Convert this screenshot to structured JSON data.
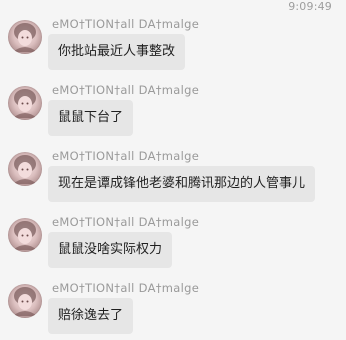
{
  "chat": {
    "timestamp": "9:09:49",
    "messages": [
      {
        "sender": "eMO†TION†all DA†malge",
        "text": "你批站最近人事整改"
      },
      {
        "sender": "eMO†TION†all DA†malge",
        "text": "鼠鼠下台了"
      },
      {
        "sender": "eMO†TION†all DA†malge",
        "text": "现在是谭成锋他老婆和腾讯那边的人管事儿"
      },
      {
        "sender": "eMO†TION†all DA†malge",
        "text": "鼠鼠没啥实际权力"
      },
      {
        "sender": "eMO†TION†all DA†malge",
        "text": "赔徐逸去了"
      }
    ]
  },
  "colors": {
    "background": "#f5f5f5",
    "bubble": "#e6e6e6",
    "sender_name": "#9a9a9a",
    "timestamp": "#9e9e9e"
  },
  "icons": {
    "avatar": "user-avatar-icon"
  }
}
